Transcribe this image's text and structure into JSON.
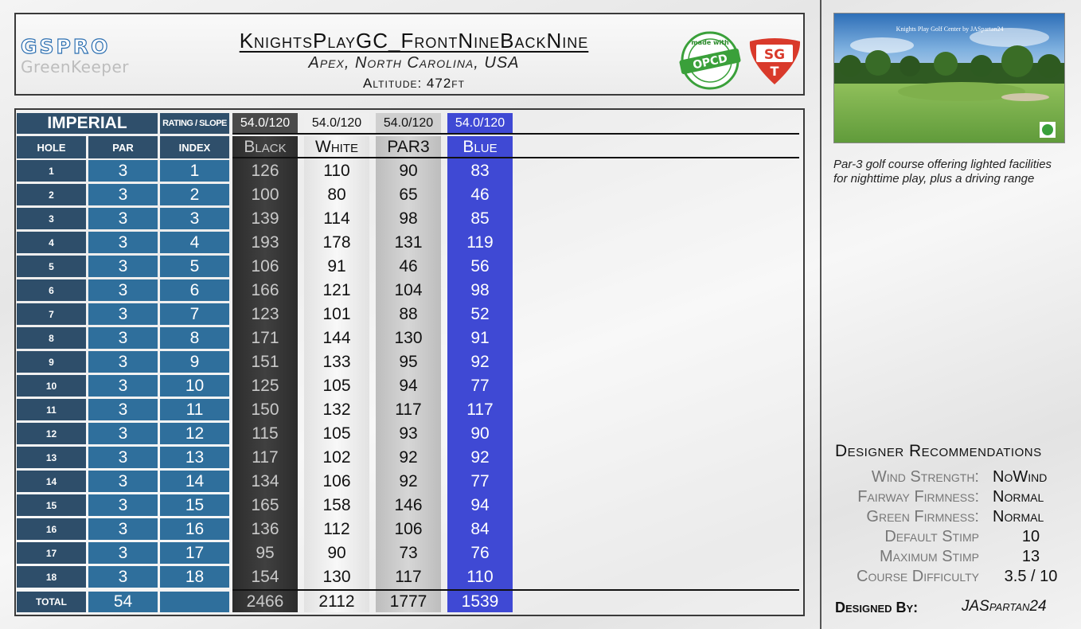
{
  "brand": {
    "logo_text": "GSPRO",
    "subtitle": "GreenKeeper"
  },
  "course": {
    "title": "KnightsPlayGC_FrontNineBackNine",
    "location": "Apex, North Carolina, USA",
    "altitude": "Altitude: 472ft"
  },
  "badges": {
    "opcd_text": "OPCD",
    "opcd_top": "made with",
    "sgt_top": "SG",
    "sgt_bottom": "T"
  },
  "scorecard": {
    "units": "IMPERIAL",
    "rating_slope_label": "RATING / SLOPE",
    "hole_label": "HOLE",
    "par_label": "PAR",
    "index_label": "INDEX",
    "total_label": "TOTAL",
    "total_par": "54",
    "tees": [
      {
        "name": "Black",
        "rating_slope": "54.0/120",
        "total": "2466",
        "color": "#2c2c2c",
        "yards": [
          "126",
          "100",
          "139",
          "193",
          "106",
          "166",
          "123",
          "171",
          "151",
          "125",
          "150",
          "115",
          "117",
          "134",
          "165",
          "136",
          "95",
          "154"
        ]
      },
      {
        "name": "White",
        "rating_slope": "54.0/120",
        "total": "2112",
        "color": "#f2f2f2",
        "yards": [
          "110",
          "80",
          "114",
          "178",
          "91",
          "121",
          "101",
          "144",
          "133",
          "105",
          "132",
          "105",
          "102",
          "106",
          "158",
          "112",
          "90",
          "130"
        ]
      },
      {
        "name": "PAR3",
        "rating_slope": "54.0/120",
        "total": "1777",
        "color": "#c8c8c8",
        "yards": [
          "90",
          "65",
          "98",
          "131",
          "46",
          "104",
          "88",
          "130",
          "95",
          "94",
          "117",
          "93",
          "92",
          "92",
          "146",
          "106",
          "73",
          "117"
        ]
      },
      {
        "name": "Blue",
        "rating_slope": "54.0/120",
        "total": "1539",
        "color": "#3f49d4",
        "yards": [
          "83",
          "46",
          "85",
          "119",
          "56",
          "98",
          "52",
          "91",
          "92",
          "77",
          "117",
          "90",
          "92",
          "77",
          "94",
          "84",
          "76",
          "110"
        ]
      }
    ],
    "holes": [
      {
        "hole": "1",
        "par": "3",
        "index": "1"
      },
      {
        "hole": "2",
        "par": "3",
        "index": "2"
      },
      {
        "hole": "3",
        "par": "3",
        "index": "3"
      },
      {
        "hole": "4",
        "par": "3",
        "index": "4"
      },
      {
        "hole": "5",
        "par": "3",
        "index": "5"
      },
      {
        "hole": "6",
        "par": "3",
        "index": "6"
      },
      {
        "hole": "7",
        "par": "3",
        "index": "7"
      },
      {
        "hole": "8",
        "par": "3",
        "index": "8"
      },
      {
        "hole": "9",
        "par": "3",
        "index": "9"
      },
      {
        "hole": "10",
        "par": "3",
        "index": "10"
      },
      {
        "hole": "11",
        "par": "3",
        "index": "11"
      },
      {
        "hole": "12",
        "par": "3",
        "index": "12"
      },
      {
        "hole": "13",
        "par": "3",
        "index": "13"
      },
      {
        "hole": "14",
        "par": "3",
        "index": "14"
      },
      {
        "hole": "15",
        "par": "3",
        "index": "15"
      },
      {
        "hole": "16",
        "par": "3",
        "index": "16"
      },
      {
        "hole": "17",
        "par": "3",
        "index": "17"
      },
      {
        "hole": "18",
        "par": "3",
        "index": "18"
      }
    ]
  },
  "preview": {
    "caption": "Knights Play Golf Center by JASpartan24"
  },
  "description": "Par-3 golf course offering lighted facilities for nighttime play, plus a driving range",
  "recommendations": {
    "title": "Designer Recommendations",
    "items": [
      {
        "label": "Wind Strength:",
        "value": "NoWind"
      },
      {
        "label": "Fairway Firmness:",
        "value": "Normal"
      },
      {
        "label": "Green Firmness:",
        "value": "Normal"
      },
      {
        "label": "Default Stimp",
        "value": "10"
      },
      {
        "label": "Maximum Stimp",
        "value": "13"
      },
      {
        "label": "Course Difficulty",
        "value": "3.5 / 10"
      }
    ]
  },
  "designer": {
    "label": "Designed By:",
    "name": "JASpartan24"
  }
}
